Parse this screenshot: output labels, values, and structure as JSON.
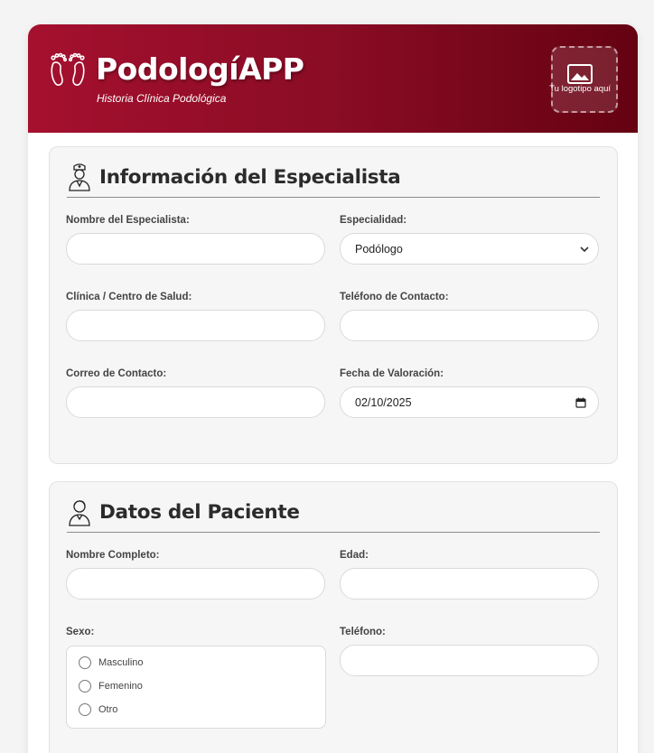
{
  "header": {
    "title": "PodologíAPP",
    "subtitle": "Historia Clínica Podológica",
    "logo_placeholder": "Tu logotipo aquí",
    "icons": {
      "brand": "feet-icon",
      "logo": "image-icon"
    },
    "colors": {
      "gradient_start": "#a5102f",
      "gradient_end": "#650212"
    }
  },
  "especialista": {
    "title": "Información del Especialista",
    "icon": "doctor-icon",
    "nombre_label": "Nombre del Especialista:",
    "nombre_value": "",
    "especialidad_label": "Especialidad:",
    "especialidad_value": "Podólogo",
    "clinica_label": "Clínica / Centro de Salud:",
    "clinica_value": "",
    "telefono_label": "Teléfono de Contacto:",
    "telefono_value": "",
    "correo_label": "Correo de Contacto:",
    "correo_value": "",
    "fecha_label": "Fecha de Valoración:",
    "fecha_value": "02/10/2025"
  },
  "paciente": {
    "title": "Datos del Paciente",
    "icon": "patient-icon",
    "nombre_label": "Nombre Completo:",
    "nombre_value": "",
    "edad_label": "Edad:",
    "edad_value": "",
    "sexo_label": "Sexo:",
    "sexo_options": [
      "Masculino",
      "Femenino",
      "Otro"
    ],
    "telefono_label": "Teléfono:",
    "telefono_value": ""
  }
}
